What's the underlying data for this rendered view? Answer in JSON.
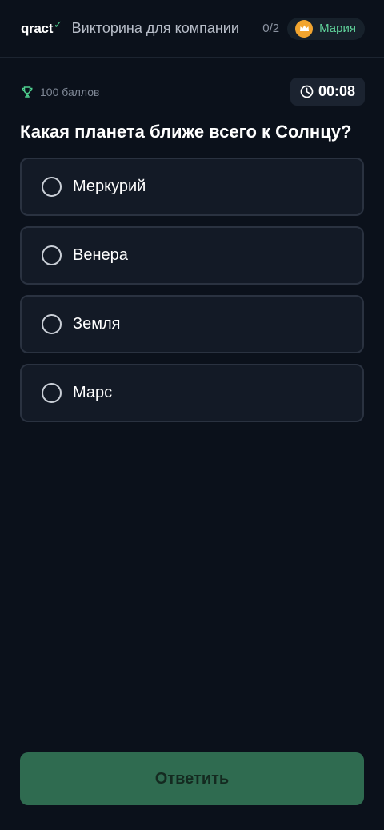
{
  "header": {
    "logo_text": "qract",
    "logo_accent": "✓",
    "quiz_title": "Викторина для компании",
    "progress": "0/2",
    "user": {
      "name": "Мария",
      "avatar_icon": "crown-icon",
      "avatar_color": "#f2a52f"
    }
  },
  "meta": {
    "points": "100 баллов",
    "points_icon": "trophy-icon",
    "timer": "00:08",
    "timer_icon": "clock-icon"
  },
  "question": {
    "text": "Какая планета ближе всего к Солнцу?",
    "options": [
      {
        "label": "Меркурий"
      },
      {
        "label": "Венера"
      },
      {
        "label": "Земля"
      },
      {
        "label": "Марс"
      }
    ]
  },
  "submit": {
    "label": "Ответить"
  },
  "colors": {
    "background": "#0b111b",
    "accent": "#4fd08f",
    "submit_bg": "#2f6b50",
    "option_bg": "#131a26",
    "option_border": "#2a3240"
  }
}
